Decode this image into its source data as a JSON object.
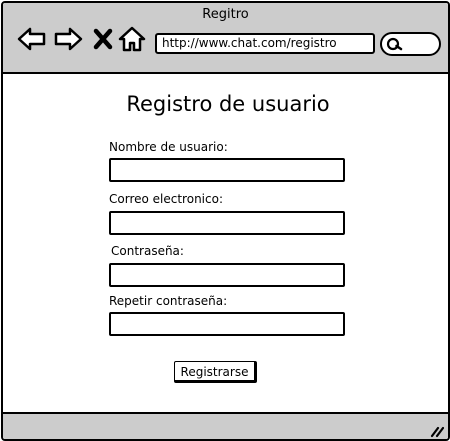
{
  "window": {
    "title": "Regitro"
  },
  "toolbar": {
    "back_icon": "arrow-left-icon",
    "forward_icon": "arrow-right-icon",
    "close_icon": "x-icon",
    "home_icon": "home-icon",
    "url": "http://www.chat.com/registro",
    "search_icon": "search-icon"
  },
  "form": {
    "title": "Registro de usuario",
    "fields": [
      {
        "label": "Nombre de usuario:",
        "value": ""
      },
      {
        "label": "Correo electronico:",
        "value": ""
      },
      {
        "label": "Contraseña:",
        "value": ""
      },
      {
        "label": "Repetir contraseña:",
        "value": ""
      }
    ],
    "submit_label": "Registrarse"
  },
  "statusbar": {
    "resize_icon": "resize-grip-icon"
  },
  "colors": {
    "chrome_bg": "#cccccc",
    "page_bg": "#ffffff",
    "stroke": "#000000"
  }
}
